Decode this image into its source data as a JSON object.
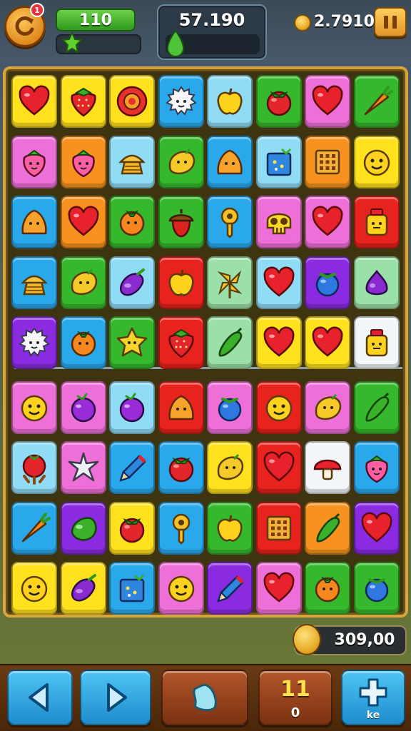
{
  "hud": {
    "level_value": "110",
    "score_value": "57.190",
    "coins_value": "2.7910",
    "notification_badge": "1"
  },
  "bank": {
    "value": "309,00"
  },
  "controls": {
    "moves_count": "11",
    "moves_sub": "0",
    "hint_sub_label": "ke"
  },
  "colors": {
    "yellow": "#ffe11e",
    "red": "#e8221c",
    "pink": "#ee6fd8",
    "blue": "#2aa8ec",
    "lightblue": "#8fdcf4",
    "green": "#36b82c",
    "orange": "#f7921e",
    "purple": "#8a2be2",
    "mint": "#9be0a8",
    "white": "#f2f6f8"
  },
  "board": {
    "rows": [
      [
        {
          "bg": "yellow",
          "icon": "heart-icon"
        },
        {
          "bg": "yellow",
          "icon": "strawberry-icon"
        },
        {
          "bg": "yellow",
          "icon": "flower-icon"
        },
        {
          "bg": "blue",
          "icon": "fuzzball-icon"
        },
        {
          "bg": "lightblue",
          "icon": "apple-icon"
        },
        {
          "bg": "green",
          "icon": "tomato-icon"
        },
        {
          "bg": "pink",
          "icon": "heart-icon"
        },
        {
          "bg": "green",
          "icon": "carrot-icon"
        }
      ],
      [
        {
          "bg": "pink",
          "icon": "berry-icon"
        },
        {
          "bg": "orange",
          "icon": "berry-icon"
        },
        {
          "bg": "lightblue",
          "icon": "cupcake-icon"
        },
        {
          "bg": "green",
          "icon": "lemon-icon"
        },
        {
          "bg": "blue",
          "icon": "blob-icon"
        },
        {
          "bg": "lightblue",
          "icon": "gift-box-icon"
        },
        {
          "bg": "orange",
          "icon": "waffle-icon"
        },
        {
          "bg": "yellow",
          "icon": "smiley-icon"
        }
      ],
      [
        {
          "bg": "blue",
          "icon": "blob-icon"
        },
        {
          "bg": "orange",
          "icon": "heart-icon"
        },
        {
          "bg": "green",
          "icon": "orange-fruit-icon"
        },
        {
          "bg": "green",
          "icon": "acorn-icon"
        },
        {
          "bg": "blue",
          "icon": "key-icon"
        },
        {
          "bg": "pink",
          "icon": "skull-icon"
        },
        {
          "bg": "pink",
          "icon": "heart-icon"
        },
        {
          "bg": "red",
          "icon": "jar-icon"
        }
      ],
      [
        {
          "bg": "blue",
          "icon": "cupcake-icon"
        },
        {
          "bg": "green",
          "icon": "lemon-icon"
        },
        {
          "bg": "lightblue",
          "icon": "eggplant-icon"
        },
        {
          "bg": "red",
          "icon": "apple-icon"
        },
        {
          "bg": "mint",
          "icon": "pinwheel-icon"
        },
        {
          "bg": "lightblue",
          "icon": "heart-icon"
        },
        {
          "bg": "purple",
          "icon": "blueberry-icon"
        },
        {
          "bg": "mint",
          "icon": "fig-icon"
        }
      ],
      [
        {
          "bg": "purple",
          "icon": "fuzzball-icon"
        },
        {
          "bg": "blue",
          "icon": "orange-fruit-icon"
        },
        {
          "bg": "green",
          "icon": "star-fruit-icon"
        },
        {
          "bg": "red",
          "icon": "strawberry-icon"
        },
        {
          "bg": "mint",
          "icon": "pepper-icon"
        },
        {
          "bg": "yellow",
          "icon": "heart-icon"
        },
        {
          "bg": "yellow",
          "icon": "heart-icon"
        },
        {
          "bg": "white",
          "icon": "jar-icon"
        }
      ],
      [
        {
          "bg": "pink",
          "icon": "smiley-icon"
        },
        {
          "bg": "pink",
          "icon": "plum-icon"
        },
        {
          "bg": "lightblue",
          "icon": "plum-icon"
        },
        {
          "bg": "red",
          "icon": "blob-icon"
        },
        {
          "bg": "pink",
          "icon": "blueberry-icon"
        },
        {
          "bg": "red",
          "icon": "smiley-icon"
        },
        {
          "bg": "pink",
          "icon": "lemon-icon"
        },
        {
          "bg": "green",
          "icon": "pepper-icon"
        }
      ],
      [
        {
          "bg": "lightblue",
          "icon": "raspberry-icon"
        },
        {
          "bg": "pink",
          "icon": "star-icon"
        },
        {
          "bg": "blue",
          "icon": "pencil-icon"
        },
        {
          "bg": "blue",
          "icon": "tomato-icon"
        },
        {
          "bg": "yellow",
          "icon": "lemon-icon"
        },
        {
          "bg": "red",
          "icon": "heart-icon"
        },
        {
          "bg": "white",
          "icon": "mushroom-icon"
        },
        {
          "bg": "blue",
          "icon": "berry-icon"
        }
      ],
      [
        {
          "bg": "blue",
          "icon": "carrot-icon"
        },
        {
          "bg": "purple",
          "icon": "lime-icon"
        },
        {
          "bg": "yellow",
          "icon": "tomato-icon"
        },
        {
          "bg": "blue",
          "icon": "key-icon"
        },
        {
          "bg": "green",
          "icon": "apple-icon"
        },
        {
          "bg": "red",
          "icon": "waffle-icon"
        },
        {
          "bg": "orange",
          "icon": "pepper-icon"
        },
        {
          "bg": "purple",
          "icon": "heart-icon"
        }
      ],
      [
        {
          "bg": "yellow",
          "icon": "smiley-icon"
        },
        {
          "bg": "yellow",
          "icon": "eggplant-icon"
        },
        {
          "bg": "blue",
          "icon": "gift-box-icon"
        },
        {
          "bg": "pink",
          "icon": "smiley-icon"
        },
        {
          "bg": "purple",
          "icon": "pencil-icon"
        },
        {
          "bg": "pink",
          "icon": "heart-icon"
        },
        {
          "bg": "green",
          "icon": "orange-fruit-icon"
        },
        {
          "bg": "green",
          "icon": "blueberry-icon"
        }
      ]
    ]
  }
}
